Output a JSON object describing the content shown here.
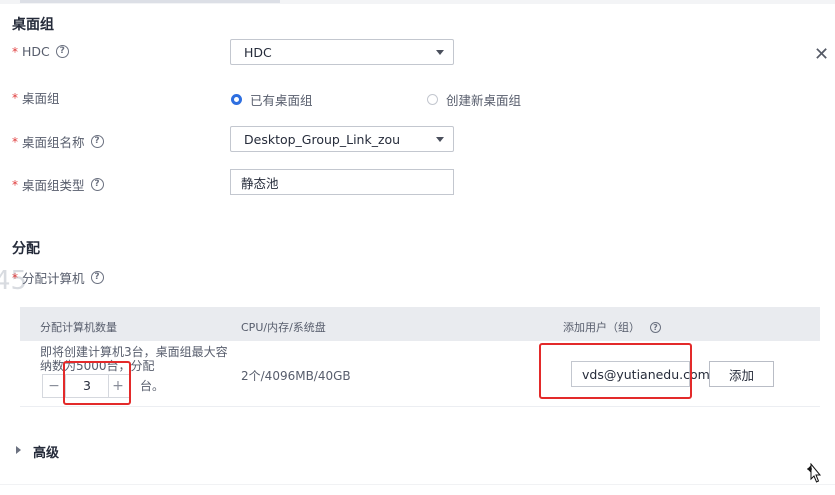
{
  "header": {
    "truncated_text": "",
    "close_icon": "close-icon"
  },
  "desktop_group": {
    "title": "桌面组",
    "hdc": {
      "label": "HDC",
      "value": "HDC"
    },
    "group": {
      "label": "桌面组",
      "option_existing": "已有桌面组",
      "option_new": "创建新桌面组",
      "selected": "已有桌面组"
    },
    "group_name": {
      "label": "桌面组名称",
      "value": "Desktop_Group_Link_zou"
    },
    "group_type": {
      "label": "桌面组类型",
      "value": "静态池"
    }
  },
  "allocation": {
    "title": "分配",
    "computer_label": "分配计算机",
    "ghost_number": "45",
    "table": {
      "headers": [
        "分配计算机数量",
        "CPU/内存/系统盘",
        "添加用户（组）"
      ],
      "row": {
        "note_line1": "即将创建计算机3台，桌面组最大容",
        "note_line2": "纳数为5000台，分配",
        "note_suffix": "台。",
        "quantity": "3",
        "minus": "−",
        "plus": "+",
        "spec": "2个/4096MB/40GB",
        "user_value": "vds@yutianedu.com",
        "add_label": "添加"
      }
    }
  },
  "advanced": {
    "title": "高级"
  },
  "colors": {
    "accent": "#2e6fe0",
    "required": "#e03c3c",
    "highlight": "#e32a2a"
  }
}
